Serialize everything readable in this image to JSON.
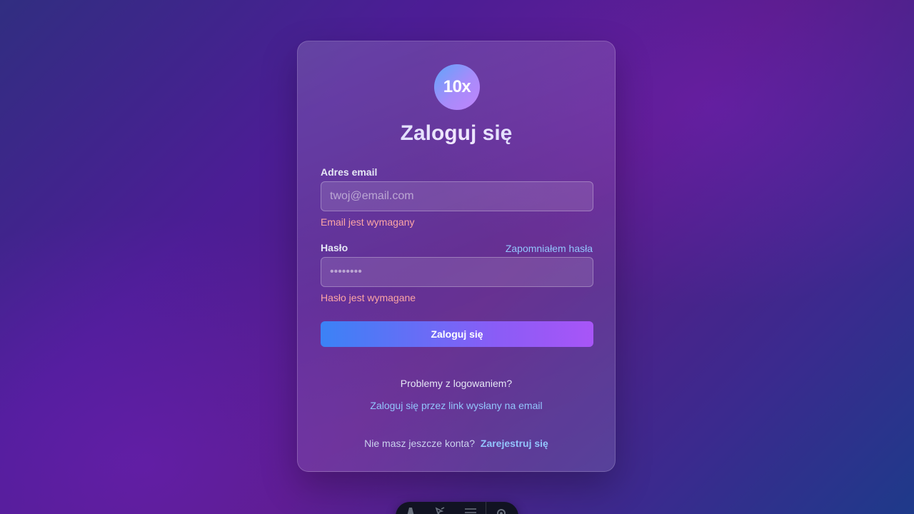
{
  "brand": {
    "logo_text": "10x"
  },
  "login": {
    "title": "Zaloguj się",
    "email": {
      "label": "Adres email",
      "placeholder": "twoj@email.com",
      "value": "",
      "error": "Email jest wymagany"
    },
    "password": {
      "label": "Hasło",
      "placeholder": "••••••••",
      "value": "",
      "error": "Hasło jest wymagane",
      "forgot_link": "Zapomniałem hasła"
    },
    "submit_label": "Zaloguj się",
    "problems_text": "Problemy z logowaniem?",
    "magic_link_text": "Zaloguj się przez link wysłany na email",
    "no_account_text": "Nie masz jeszcze konta?",
    "signup_link": "Zarejestruj się"
  },
  "dev_toolbar": {
    "icons": [
      "astro-icon",
      "inspect-icon",
      "audit-icon",
      "settings-icon"
    ]
  },
  "colors": {
    "accent_link": "#93c5fd",
    "error": "#fca5a5",
    "button_gradient_start": "#3b82f6",
    "button_gradient_end": "#a855f7"
  }
}
